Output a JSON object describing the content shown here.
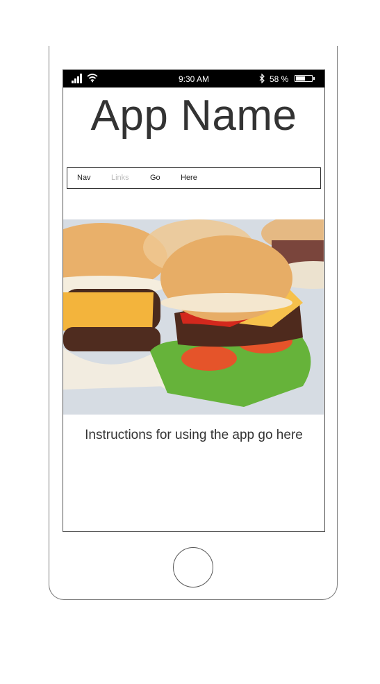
{
  "status_bar": {
    "time": "9:30 AM",
    "battery_text": "58 %",
    "battery_level": 0.58,
    "icons": [
      "signal-icon",
      "wifi-icon",
      "bluetooth-icon",
      "battery-icon"
    ]
  },
  "app": {
    "title": "App Name",
    "instructions": "Instructions for using the app go here"
  },
  "nav": {
    "links": [
      {
        "label": "Nav",
        "disabled": false
      },
      {
        "label": "Links",
        "disabled": true
      },
      {
        "label": "Go",
        "disabled": false
      },
      {
        "label": "Here",
        "disabled": false
      }
    ]
  },
  "colors": {
    "status_bar_bg": "#000000",
    "text": "#333333",
    "disabled_link": "#bbbbbb"
  },
  "hero_image": {
    "subject": "burger-sliders-photo"
  }
}
